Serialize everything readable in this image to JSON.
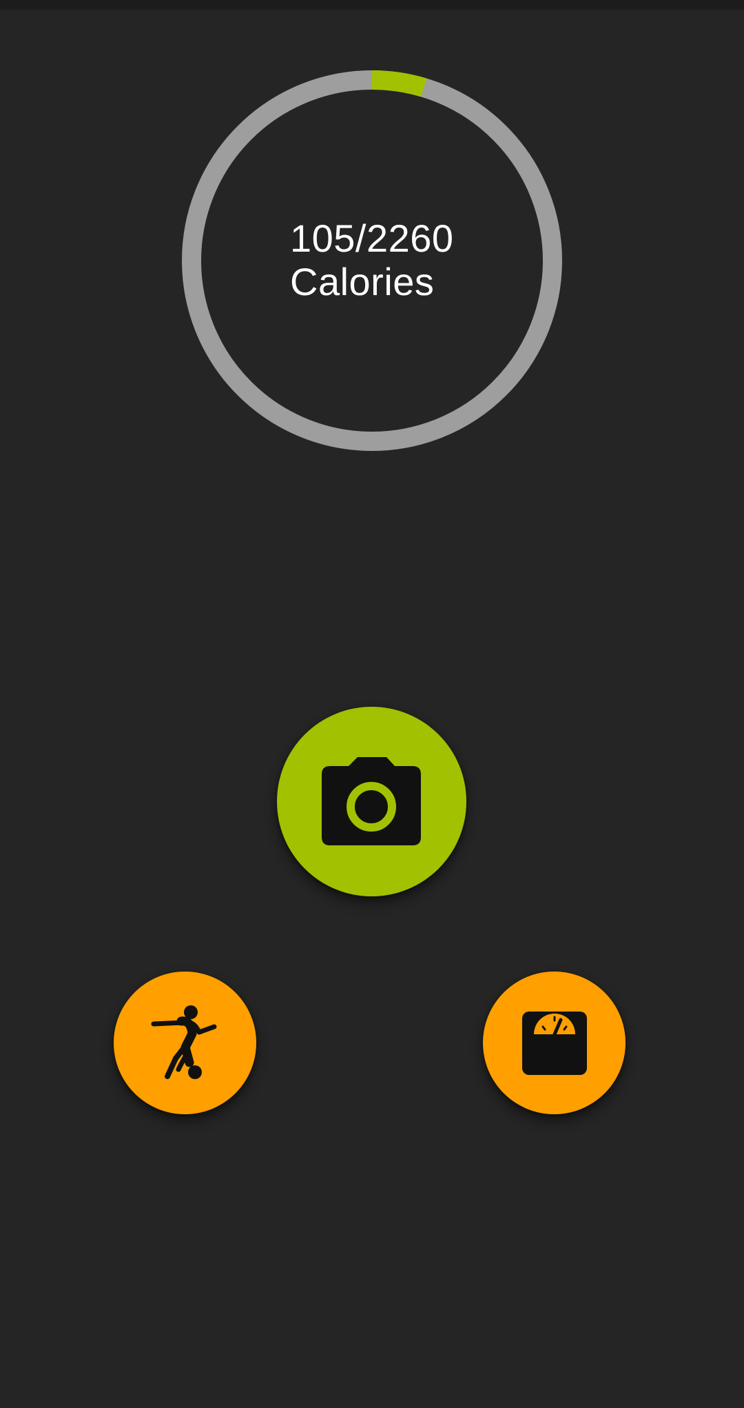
{
  "calorie_ring": {
    "consumed": 105,
    "goal": 2260,
    "value_text": "105/2260",
    "unit_label": "Calories",
    "progress_color": "#a2c100",
    "track_color": "#9e9e9e"
  },
  "actions": {
    "camera": {
      "icon": "camera-icon",
      "color": "#a2c100"
    },
    "exercise": {
      "icon": "soccer-player-icon",
      "color": "#ff9f00"
    },
    "weight": {
      "icon": "bathroom-scale-icon",
      "color": "#ff9f00"
    }
  },
  "colors": {
    "background": "#252525",
    "status_bar": "#1c1c1c"
  }
}
